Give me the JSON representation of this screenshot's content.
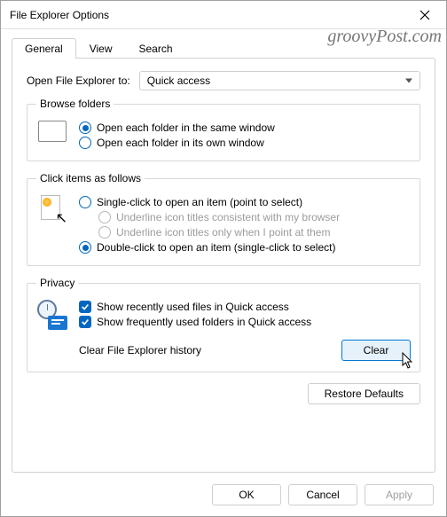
{
  "window": {
    "title": "File Explorer Options"
  },
  "watermark": "groovyPost.com",
  "tabs": {
    "general": "General",
    "view": "View",
    "search": "Search"
  },
  "open_to": {
    "label": "Open File Explorer to:",
    "value": "Quick access"
  },
  "browse": {
    "legend": "Browse folders",
    "same": "Open each folder in the same window",
    "own": "Open each folder in its own window"
  },
  "click": {
    "legend": "Click items as follows",
    "single": "Single-click to open an item (point to select)",
    "underline_browser": "Underline icon titles consistent with my browser",
    "underline_point": "Underline icon titles only when I point at them",
    "double": "Double-click to open an item (single-click to select)"
  },
  "privacy": {
    "legend": "Privacy",
    "recent_files": "Show recently used files in Quick access",
    "freq_folders": "Show frequently used folders in Quick access",
    "clear_label": "Clear File Explorer history",
    "clear_btn": "Clear"
  },
  "restore": "Restore Defaults",
  "footer": {
    "ok": "OK",
    "cancel": "Cancel",
    "apply": "Apply"
  }
}
